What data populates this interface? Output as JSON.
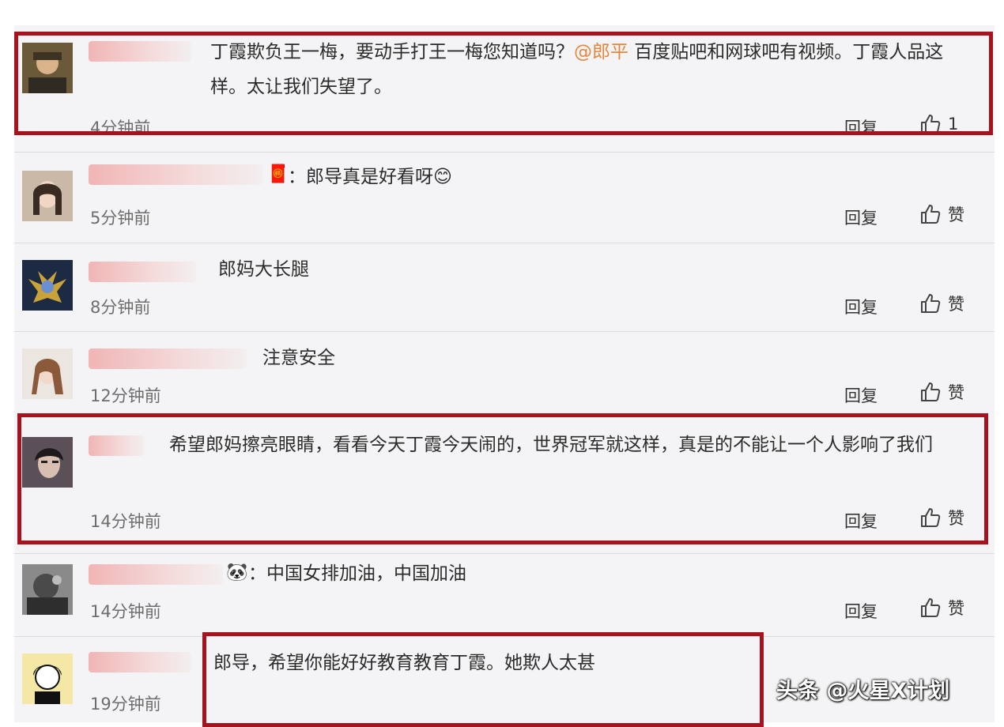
{
  "comments": [
    {
      "text": "丁霞欺负王一梅，要动手打王一梅您知道吗？",
      "mention": "@郎平",
      "text_tail": " 百度贴吧和网球吧有视频。丁霞人品这样。太让我们失望了。",
      "time": "4分钟前",
      "reply": "回复",
      "like": "1"
    },
    {
      "text": "：郎导真是好看呀",
      "emoji": "😊",
      "time": "5分钟前",
      "reply": "回复",
      "like": "赞"
    },
    {
      "text": "郎妈大长腿",
      "time": "8分钟前",
      "reply": "回复",
      "like": "赞"
    },
    {
      "text": "注意安全",
      "time": "12分钟前",
      "reply": "回复",
      "like": "赞"
    },
    {
      "text": "希望郎妈擦亮眼睛，看看今天丁霞今天闹的，世界冠军就这样，真是的不能让一个人影响了我们",
      "time": "14分钟前",
      "reply": "回复",
      "like": "赞"
    },
    {
      "text": "：中国女排加油，中国加油",
      "time": "14分钟前",
      "reply": "回复",
      "like": "赞"
    },
    {
      "text": "郎导，希望你能好好教育教育丁霞。她欺人太甚",
      "time": "19分钟前"
    }
  ],
  "watermark": "头条 @火星X计划",
  "colors": {
    "highlight": "#a6121e",
    "mention": "#e3873d",
    "background": "#f4f4f6"
  }
}
